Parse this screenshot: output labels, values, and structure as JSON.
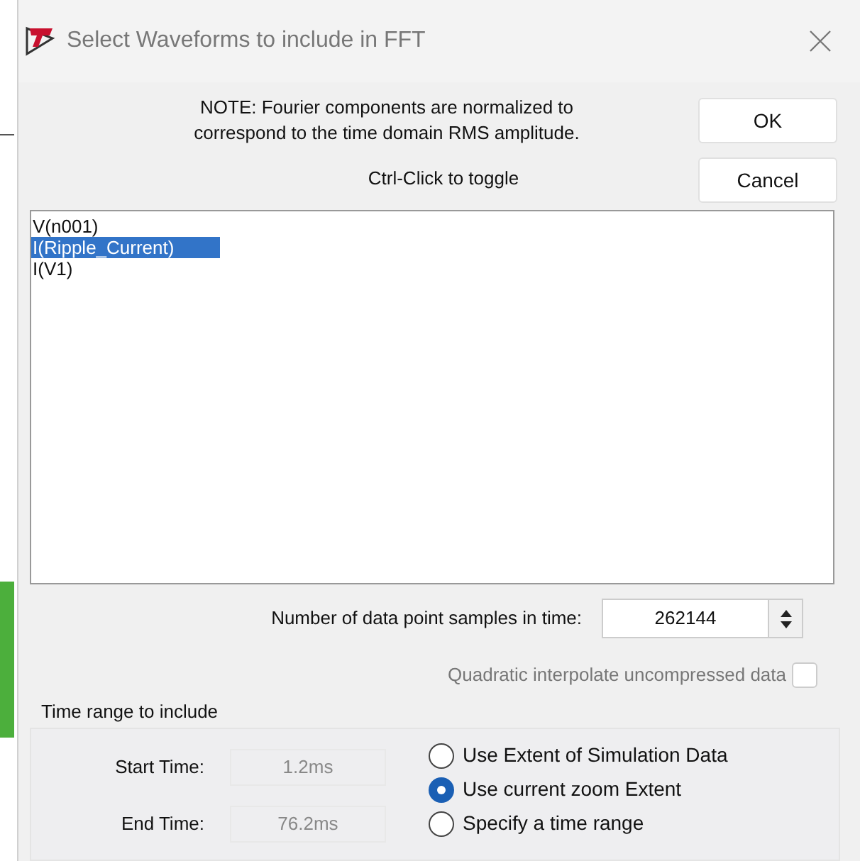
{
  "window": {
    "title": "Select Waveforms to include in FFT"
  },
  "note": [
    "NOTE:  Fourier components are normalized to",
    "correspond to the time domain RMS amplitude."
  ],
  "hint": "Ctrl-Click to toggle",
  "buttons": [
    "OK",
    "Cancel"
  ],
  "waveforms": [
    {
      "label": "V(n001)",
      "selected": false
    },
    {
      "label": "I(Ripple_Current)",
      "selected": true
    },
    {
      "label": "I(V1)",
      "selected": false
    }
  ],
  "samples": {
    "label": "Number of data point samples in time:",
    "value": "262144"
  },
  "interpolate": {
    "label": "Quadratic interpolate uncompressed data",
    "checked": false,
    "disabled": true
  },
  "time_range": {
    "title": "Time range to include",
    "fields": [
      {
        "label": "Start Time:",
        "value": "1.2ms"
      },
      {
        "label": "End Time:",
        "value": "76.2ms"
      }
    ],
    "options": [
      {
        "label": "Use Extent of Simulation Data",
        "selected": false
      },
      {
        "label": "Use current zoom Extent",
        "selected": true
      },
      {
        "label": "Specify a time range",
        "selected": false
      }
    ]
  }
}
